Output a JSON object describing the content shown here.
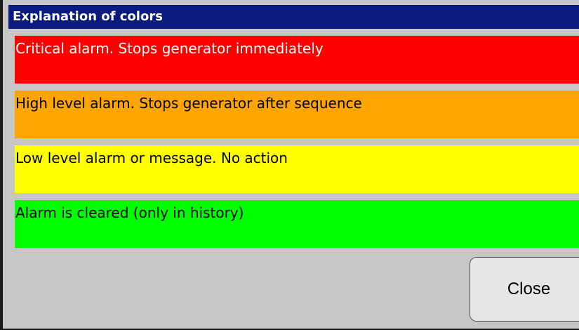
{
  "dialog": {
    "title": "Explanation of colors"
  },
  "legend": [
    {
      "label": "Critical alarm. Stops generator immediately",
      "color": "#ff0000",
      "text_color": "#ffffff"
    },
    {
      "label": "High level alarm. Stops generator after sequence",
      "color": "#ffa500",
      "text_color": "#000000"
    },
    {
      "label": "Low level alarm or message. No action",
      "color": "#ffff00",
      "text_color": "#000000"
    },
    {
      "label": "Alarm is cleared (only in history)",
      "color": "#00ff00",
      "text_color": "#000000"
    }
  ],
  "buttons": {
    "close_label": "Close"
  },
  "colors": {
    "titlebar": "#0a1a7e",
    "dialog_background": "#c6c6c6"
  }
}
